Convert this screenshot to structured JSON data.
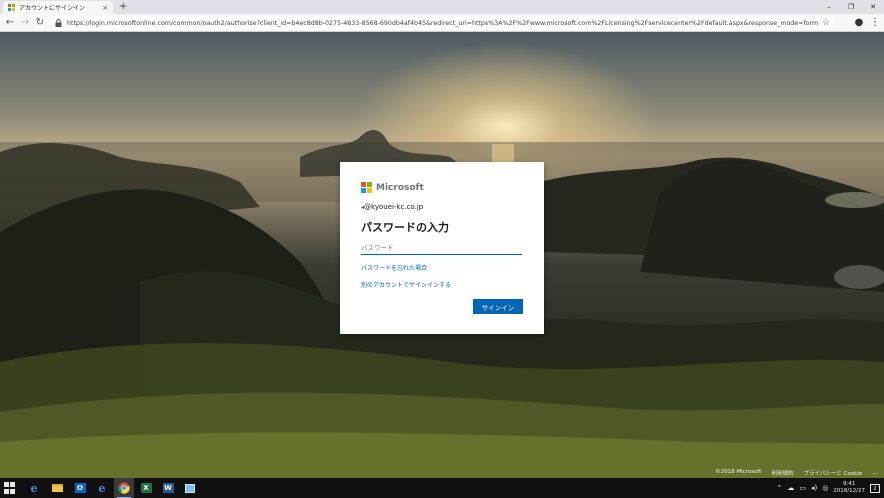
{
  "browser": {
    "tab_title": "アカウントにサインイン",
    "tab_close": "×",
    "new_tab": "+",
    "url": "https://login.microsoftonline.com/common/oauth2/authorize?client_id=b4ec8d8b-0275-4833-8568-690db4af4b45&redirect_uri=https%3A%2F%2Fwww.microsoft.com%2FLicensing%2Fservicecenter%2Fdefault.aspx&response_mode=form_post&response_type=code%...",
    "window_controls": {
      "minimize": "–",
      "maximize": "❐",
      "close": "✕"
    }
  },
  "signin": {
    "brand": "Microsoft",
    "identity": "@kyouei-kc.co.jp",
    "title": "パスワードの入力",
    "password_placeholder": "パスワード",
    "forgot_link": "パスワードを忘れた場合",
    "other_account_link": "別のアカウントでサインインする",
    "signin_button": "サインイン"
  },
  "footer": {
    "copyright": "©2018 Microsoft",
    "terms": "利用規約",
    "privacy": "プライバシーと Cookie",
    "more": "..."
  },
  "taskbar": {
    "time": "9:41",
    "date": "2018/12/27",
    "notification_count": "2",
    "apps": [
      "ie-icon",
      "file-explorer-icon",
      "outlook-icon",
      "edge-icon",
      "chrome-icon",
      "excel-icon",
      "word-icon",
      "snipping-tool-icon"
    ]
  },
  "colors": {
    "accent": "#0067b8",
    "ms_red": "#f25022",
    "ms_green": "#7fba00",
    "ms_blue": "#00a4ef",
    "ms_yellow": "#ffb900"
  }
}
